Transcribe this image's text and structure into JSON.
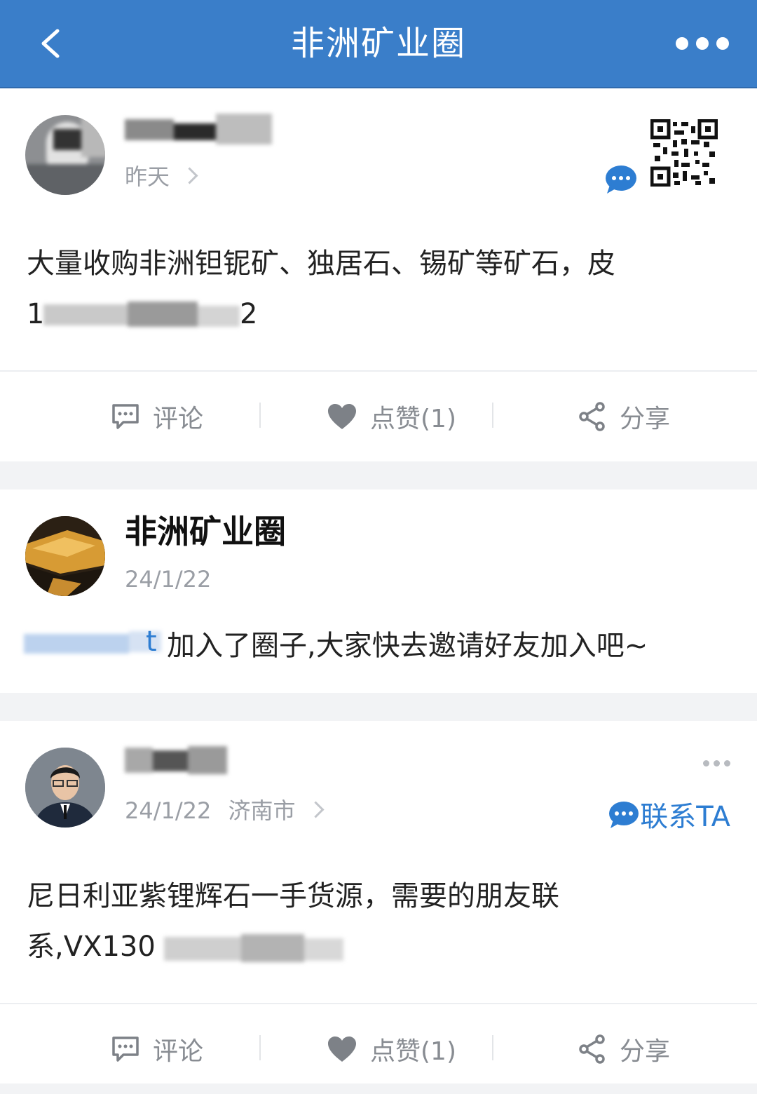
{
  "header": {
    "title": "非洲矿业圈",
    "back_icon": "chevron-left-icon",
    "more_icon": "more-dots-icon"
  },
  "posts": [
    {
      "time": "昨天",
      "text": "大量收购非洲钽铌矿、独居石、锡矿等矿石，皮",
      "text_line2_visible": "1",
      "text_line2_tail": "2",
      "actions": {
        "comment": "评论",
        "like": "点赞(1)",
        "share": "分享"
      }
    },
    {
      "name": "非洲矿业圈",
      "time": "24/1/22",
      "message": "加入了圈子,大家快去邀请好友加入吧~",
      "member_visible_tail": "t"
    },
    {
      "time": "24/1/22",
      "location": "济南市",
      "contact": "联系TA",
      "text_line1": "尼日利亚紫锂辉石一手货源，需要的朋友联",
      "text_line2": "系,VX130",
      "actions": {
        "comment": "评论",
        "like": "点赞(1)",
        "share": "分享"
      }
    }
  ],
  "colors": {
    "primary": "#3a7ec9",
    "link": "#2d7dd2",
    "muted": "#9a9ea5"
  }
}
